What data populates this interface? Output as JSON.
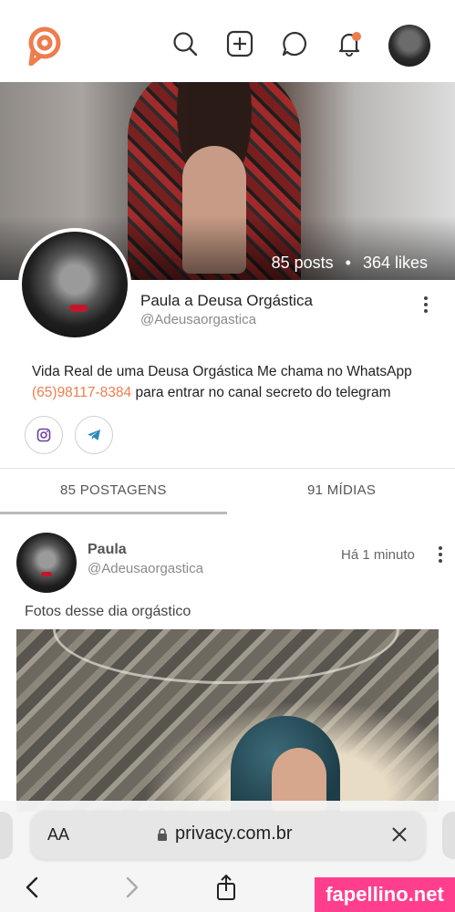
{
  "header": {
    "logo": "privacy-logo",
    "icons": [
      "search-icon",
      "add-icon",
      "chat-icon",
      "bell-icon"
    ],
    "accent_color": "#ee7d4e"
  },
  "profile": {
    "posts_count": "85 posts",
    "separator": "•",
    "likes_count": "364 likes",
    "display_name": "Paula a Deusa Orgástica",
    "username": "@Adeusaorgastica",
    "bio_text_before": "Vida Real de uma Deusa Orgástica Me chama no WhatsApp ",
    "bio_phone": "(65)98117-8384",
    "bio_text_after": " para entrar no canal secreto do telegram",
    "social": [
      "instagram-icon",
      "telegram-icon"
    ]
  },
  "tabs": [
    {
      "label": "85 POSTAGENS",
      "active": true
    },
    {
      "label": "91 MÍDIAS",
      "active": false
    }
  ],
  "post": {
    "name": "Paula",
    "username": "@Adeusaorgastica",
    "time": "Há 1 minuto",
    "text": "Fotos desse dia orgástico"
  },
  "browser": {
    "aa_label": "AA",
    "url": "privacy.com.br"
  },
  "watermark": "fapellino.net"
}
